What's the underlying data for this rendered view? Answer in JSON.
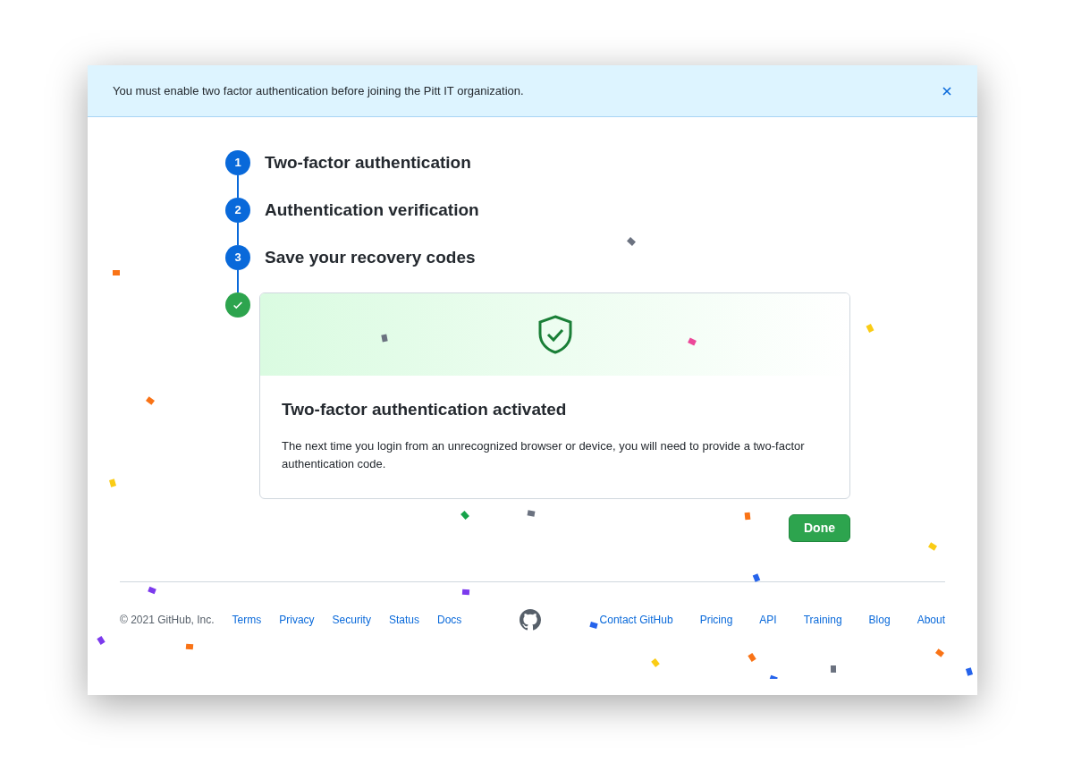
{
  "banner": {
    "message": "You must enable two factor authentication before joining the Pitt IT organization."
  },
  "steps": [
    {
      "kind": "number",
      "marker": "1",
      "label": "Two-factor authentication"
    },
    {
      "kind": "number",
      "marker": "2",
      "label": "Authentication verification"
    },
    {
      "kind": "number",
      "marker": "3",
      "label": "Save your recovery codes"
    },
    {
      "kind": "done"
    }
  ],
  "result_card": {
    "title": "Two-factor authentication activated",
    "body": "The next time you login from an unrecognized browser or device, you will need to provide a two-factor authentication code."
  },
  "done_button": "Done",
  "footer": {
    "copyright": "© 2021 GitHub, Inc.",
    "left_links": [
      "Terms",
      "Privacy",
      "Security",
      "Status",
      "Docs"
    ],
    "right_links": [
      "Contact GitHub",
      "Pricing",
      "API",
      "Training",
      "Blog",
      "About"
    ]
  }
}
